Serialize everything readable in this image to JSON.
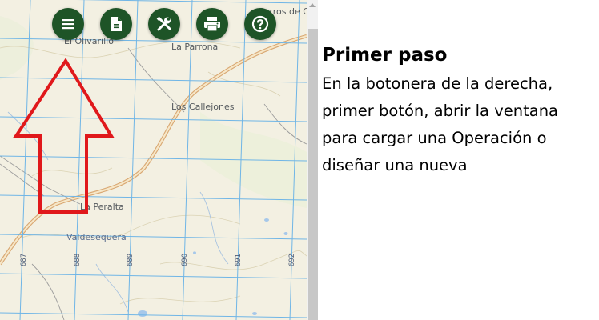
{
  "map": {
    "places": [
      {
        "key": "el_olivarillo",
        "text": "El Olivarillo"
      },
      {
        "key": "la_parrona",
        "text": "La Parrona"
      },
      {
        "key": "los_callejones",
        "text": "Los Callejones"
      },
      {
        "key": "la_peralta",
        "text": "La Peralta"
      },
      {
        "key": "valdesequera",
        "text": "Valdesequera"
      },
      {
        "key": "cerros",
        "text": "Cerros de C"
      }
    ],
    "grid_labels": [
      "687",
      "688",
      "689",
      "690",
      "691",
      "692"
    ]
  },
  "toolbar": {
    "buttons": [
      {
        "name": "menu-button",
        "icon": "hamburger-menu-icon"
      },
      {
        "name": "document-button",
        "icon": "document-icon"
      },
      {
        "name": "tools-button",
        "icon": "tools-icon"
      },
      {
        "name": "print-button",
        "icon": "printer-icon"
      },
      {
        "name": "help-button",
        "icon": "help-circle-icon"
      }
    ],
    "color": "#1e5427"
  },
  "annotation": {
    "arrow_color": "#e0181b"
  },
  "panel": {
    "title": "Primer paso",
    "body": "En la botonera de la derecha, primer botón, abrir la ventana para cargar una Operación o diseñar una nueva"
  }
}
